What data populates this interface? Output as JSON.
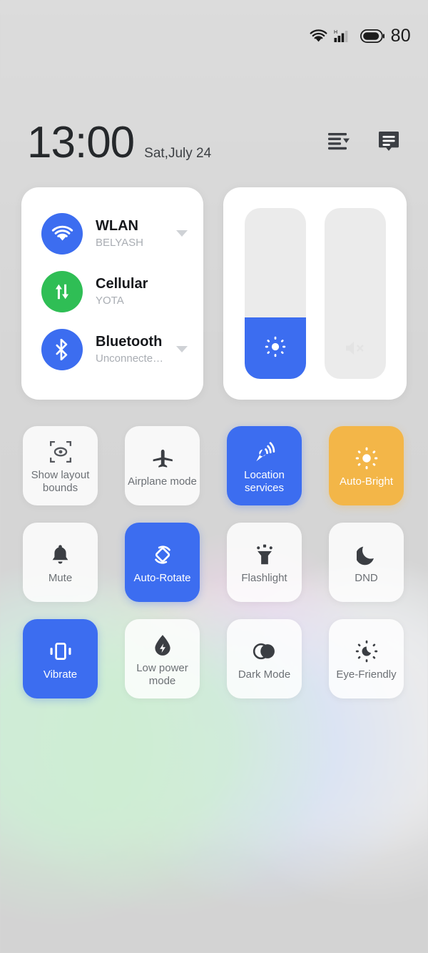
{
  "statusbar": {
    "wifi_icon": "wifi-icon",
    "signal_icon": "cellular-signal-icon",
    "network_type": "H",
    "battery_icon": "battery-icon",
    "battery_level": "80"
  },
  "header": {
    "time": "13:00",
    "date": "Sat,July 24",
    "edit_icon": "sort-list-icon",
    "notifications_icon": "message-icon"
  },
  "connectivity": {
    "items": [
      {
        "name": "WLAN",
        "status": "BELYASH",
        "icon": "wifi-icon",
        "color": "#3c6df0",
        "active": true,
        "expandable": true
      },
      {
        "name": "Cellular",
        "status": "YOTA",
        "icon": "data-transfer-icon",
        "color": "#2fbe55",
        "active": true,
        "expandable": false
      },
      {
        "name": "Bluetooth",
        "status": "Unconnecte…",
        "icon": "bluetooth-icon",
        "color": "#3c6df0",
        "active": true,
        "expandable": true
      }
    ]
  },
  "sliders": [
    {
      "name": "brightness",
      "icon": "brightness-icon",
      "value_percent": 36,
      "fill_color": "#3c6df0",
      "track_color": "#ebebeb"
    },
    {
      "name": "volume",
      "icon": "volume-mute-icon",
      "value_percent": 0,
      "fill_color": "#3c6df0",
      "track_color": "#ebebeb"
    }
  ],
  "tiles": [
    [
      {
        "label": "Show layout bounds",
        "icon": "layout-bounds-icon",
        "state": "off"
      },
      {
        "label": "Airplane mode",
        "icon": "airplane-icon",
        "state": "off"
      },
      {
        "label": "Location services",
        "icon": "location-icon",
        "state": "on-blue"
      },
      {
        "label": "Auto-Bright",
        "icon": "auto-brightness-icon",
        "state": "on-orange"
      }
    ],
    [
      {
        "label": "Mute",
        "icon": "bell-icon",
        "state": "off"
      },
      {
        "label": "Auto-Rotate",
        "icon": "auto-rotate-icon",
        "state": "on-blue"
      },
      {
        "label": "Flashlight",
        "icon": "flashlight-icon",
        "state": "off"
      },
      {
        "label": "DND",
        "icon": "moon-icon",
        "state": "off"
      }
    ],
    [
      {
        "label": "Vibrate",
        "icon": "vibrate-icon",
        "state": "on-blue"
      },
      {
        "label": "Low power mode",
        "icon": "low-power-icon",
        "state": "off"
      },
      {
        "label": "Dark Mode",
        "icon": "dark-mode-icon",
        "state": "off"
      },
      {
        "label": "Eye-Friendly",
        "icon": "eye-friendly-icon",
        "state": "off"
      }
    ]
  ],
  "colors": {
    "accent_blue": "#3c6df0",
    "accent_green": "#2fbe55",
    "accent_orange": "#f3b648",
    "background": "#d7d7d7",
    "card": "#ffffff"
  }
}
